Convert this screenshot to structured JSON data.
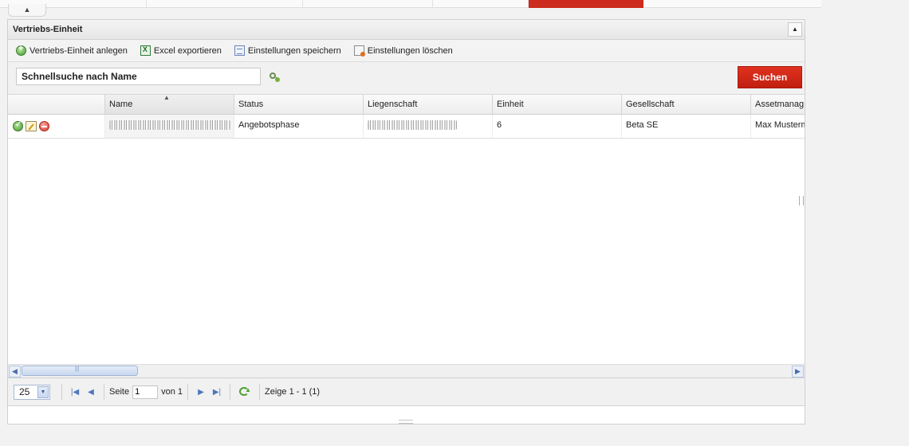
{
  "top": {
    "collapse_glyph": "▲"
  },
  "panel": {
    "title": "Vertriebs-Einheit",
    "tool_glyph": "▲"
  },
  "toolbar": {
    "add_label": "Vertriebs-Einheit anlegen",
    "excel_label": "Excel exportieren",
    "save_label": "Einstellungen speichern",
    "delete_label": "Einstellungen löschen"
  },
  "search": {
    "value": "Schnellsuche nach Name",
    "button_label": "Suchen"
  },
  "grid": {
    "columns": [
      "",
      "Name",
      "Status",
      "Liegenschaft",
      "Einheit",
      "Gesellschaft",
      "Assetmanag"
    ],
    "sorted_column": "Name",
    "rows": [
      {
        "name": "",
        "status": "Angebotsphase",
        "liegenschaft": "",
        "einheit": "6",
        "gesellschaft": "Beta SE",
        "assetmanager": "Max Musterm"
      }
    ]
  },
  "pager": {
    "page_size": "25",
    "page_label": "Seite",
    "page_value": "1",
    "of_label": "von 1",
    "display_text": "Zeige 1 - 1 (1)"
  },
  "colors": {
    "accent": "#cc2b1d",
    "pager_icon": "#4e77be",
    "refresh": "#4e9f34"
  },
  "icons": [
    "add-icon",
    "excel-icon",
    "save-settings-icon",
    "delete-settings-icon",
    "search-go-icon",
    "approve-icon",
    "edit-icon",
    "delete-icon",
    "first-page-icon",
    "prev-page-icon",
    "next-page-icon",
    "last-page-icon",
    "refresh-icon"
  ]
}
